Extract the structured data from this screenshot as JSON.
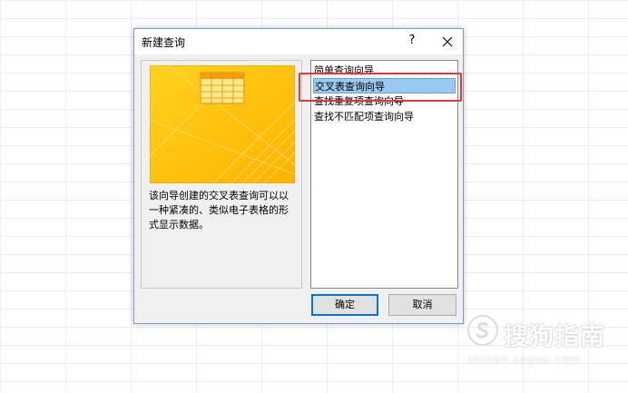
{
  "dialog": {
    "title": "新建查询",
    "help_label": "?",
    "description": "该向导创建的交叉表查询可以以一种紧凑的、类似电子表格的形式显示数据。",
    "wizards": [
      {
        "label": "简单查询向导",
        "selected": false
      },
      {
        "label": "交叉表查询向导",
        "selected": true
      },
      {
        "label": "查找重复项查询向导",
        "selected": false
      },
      {
        "label": "查找不匹配项查询向导",
        "selected": false
      }
    ],
    "ok_label": "确定",
    "cancel_label": "取消"
  },
  "watermark": {
    "name": "搜狗指南",
    "url": "zhinan.sogou.com"
  },
  "colors": {
    "preview_yellow": "#ffc000",
    "selection": "#99c9ef",
    "annotation_red": "#e8343c"
  }
}
